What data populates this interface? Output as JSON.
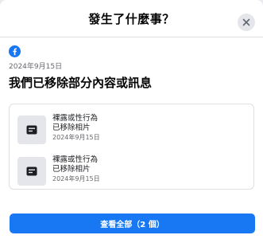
{
  "header": {
    "title": "發生了什麼事？"
  },
  "notice": {
    "date": "2024年9月15日",
    "title": "我們已移除部分內容或訊息"
  },
  "items": [
    {
      "reason": "裸露或性行為",
      "status": "已移除相片",
      "date": "2024年9月15日"
    },
    {
      "reason": "裸露或性行為",
      "status": "已移除相片",
      "date": "2024年9月15日"
    }
  ],
  "footer": {
    "view_all_label": "查看全部（2 個）"
  },
  "colors": {
    "brand_blue": "#1877f2",
    "thumb_bg": "#e4e6eb"
  },
  "icons": {
    "logo": "facebook-logo-icon",
    "close": "close-icon",
    "item": "message-icon"
  }
}
